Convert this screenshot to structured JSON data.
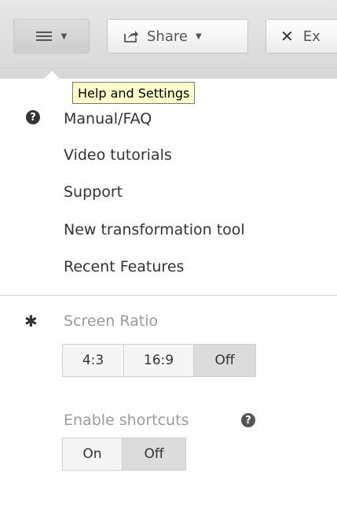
{
  "toolbar": {
    "share_label": "Share",
    "exit_label": "Ex"
  },
  "tooltip": "Help and Settings",
  "menu": {
    "items": [
      {
        "label": "Manual/FAQ"
      },
      {
        "label": "Video tutorials"
      },
      {
        "label": "Support"
      },
      {
        "label": "New transformation tool"
      },
      {
        "label": "Recent Features"
      }
    ]
  },
  "screen_ratio": {
    "label": "Screen Ratio",
    "options": [
      "4:3",
      "16:9",
      "Off"
    ],
    "selected": "Off"
  },
  "shortcuts": {
    "label": "Enable shortcuts",
    "options": [
      "On",
      "Off"
    ],
    "selected": "Off"
  }
}
